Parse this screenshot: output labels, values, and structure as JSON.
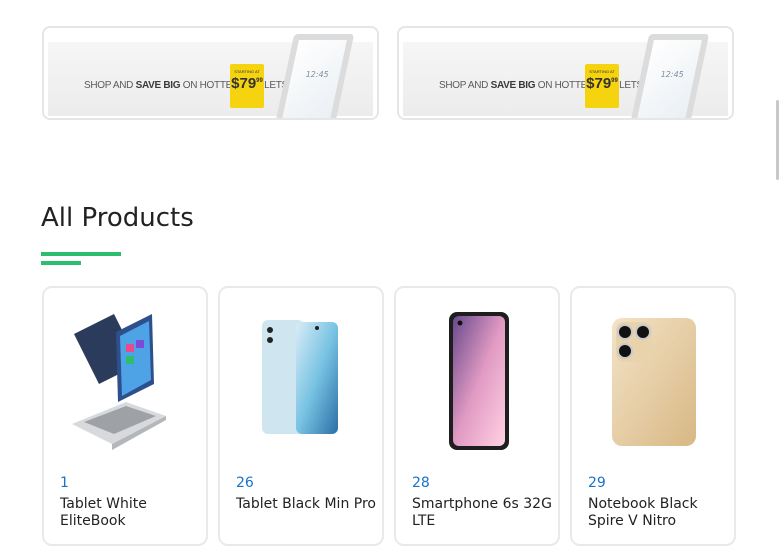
{
  "banners": [
    {
      "text_pre": "SHOP AND",
      "text_bold": "SAVE BIG",
      "text_post": "ON HOTTEST TABLETS",
      "price_caption": "STARTING AT",
      "price": "$79",
      "price_cents": "99",
      "clock": "12:45"
    },
    {
      "text_pre": "SHOP AND",
      "text_bold": "SAVE BIG",
      "text_post": "ON HOTTEST TABLETS",
      "price_caption": "STARTING AT",
      "price": "$79",
      "price_cents": "99",
      "clock": "12:45"
    }
  ],
  "section": {
    "title": "All Products"
  },
  "products": [
    {
      "id": "1",
      "name": "Tablet White EliteBook"
    },
    {
      "id": "26",
      "name": "Tablet Black Min Pro"
    },
    {
      "id": "28",
      "name": "Smartphone 6s 32G LTE"
    },
    {
      "id": "29",
      "name": "Notebook Black Spire V Nitro"
    }
  ],
  "colors": {
    "accent": "#2ebd6f",
    "link": "#1a73c7"
  }
}
